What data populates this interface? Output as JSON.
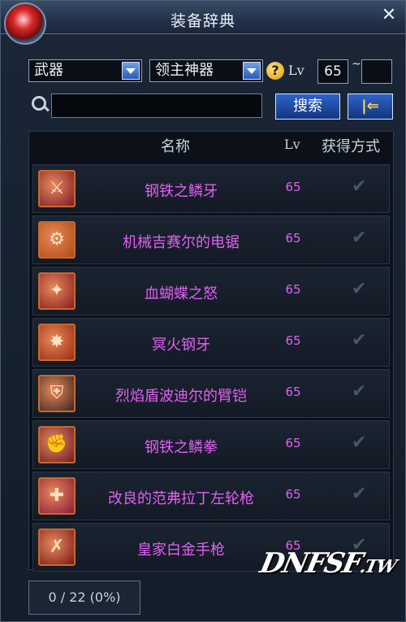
{
  "window": {
    "title": "装备辞典",
    "close_icon": "close-icon"
  },
  "filters": {
    "category": "武器",
    "subcategory": "领主神器",
    "lv_label": "Lv",
    "lv_min": "65",
    "lv_max": "",
    "tilde": "~"
  },
  "search": {
    "value": "",
    "button_label": "搜索",
    "back_glyph": "|⇐"
  },
  "table": {
    "headers": {
      "name": "名称",
      "lv": "Lv",
      "obtain": "获得方式"
    },
    "rows": [
      {
        "name": "钢铁之鳞牙",
        "lv": "65",
        "icon": "dagger-icon",
        "color": "#7a1a2a"
      },
      {
        "name": "机械吉赛尔的电锯",
        "lv": "65",
        "icon": "chainsaw-icon",
        "color": "#b04a14"
      },
      {
        "name": "血蝴蝶之怒",
        "lv": "65",
        "icon": "blade-icon",
        "color": "#8a1a24"
      },
      {
        "name": "冥火钢牙",
        "lv": "65",
        "icon": "flame-icon",
        "color": "#9a2a14"
      },
      {
        "name": "烈焰盾波迪尔的臂铠",
        "lv": "65",
        "icon": "gauntlet-icon",
        "color": "#3a2420"
      },
      {
        "name": "钢铁之鳞拳",
        "lv": "65",
        "icon": "fist-icon",
        "color": "#6a1a2a"
      },
      {
        "name": "改良的范弗拉丁左轮枪",
        "lv": "65",
        "icon": "revolver-icon",
        "color": "#8a1a3a"
      },
      {
        "name": "皇家白金手枪",
        "lv": "65",
        "icon": "pistol-icon",
        "color": "#7a1a1a"
      }
    ]
  },
  "status": {
    "text": "0 / 22 (0%)"
  },
  "watermark": {
    "text": "DNFSF",
    "suffix": ".TW"
  }
}
